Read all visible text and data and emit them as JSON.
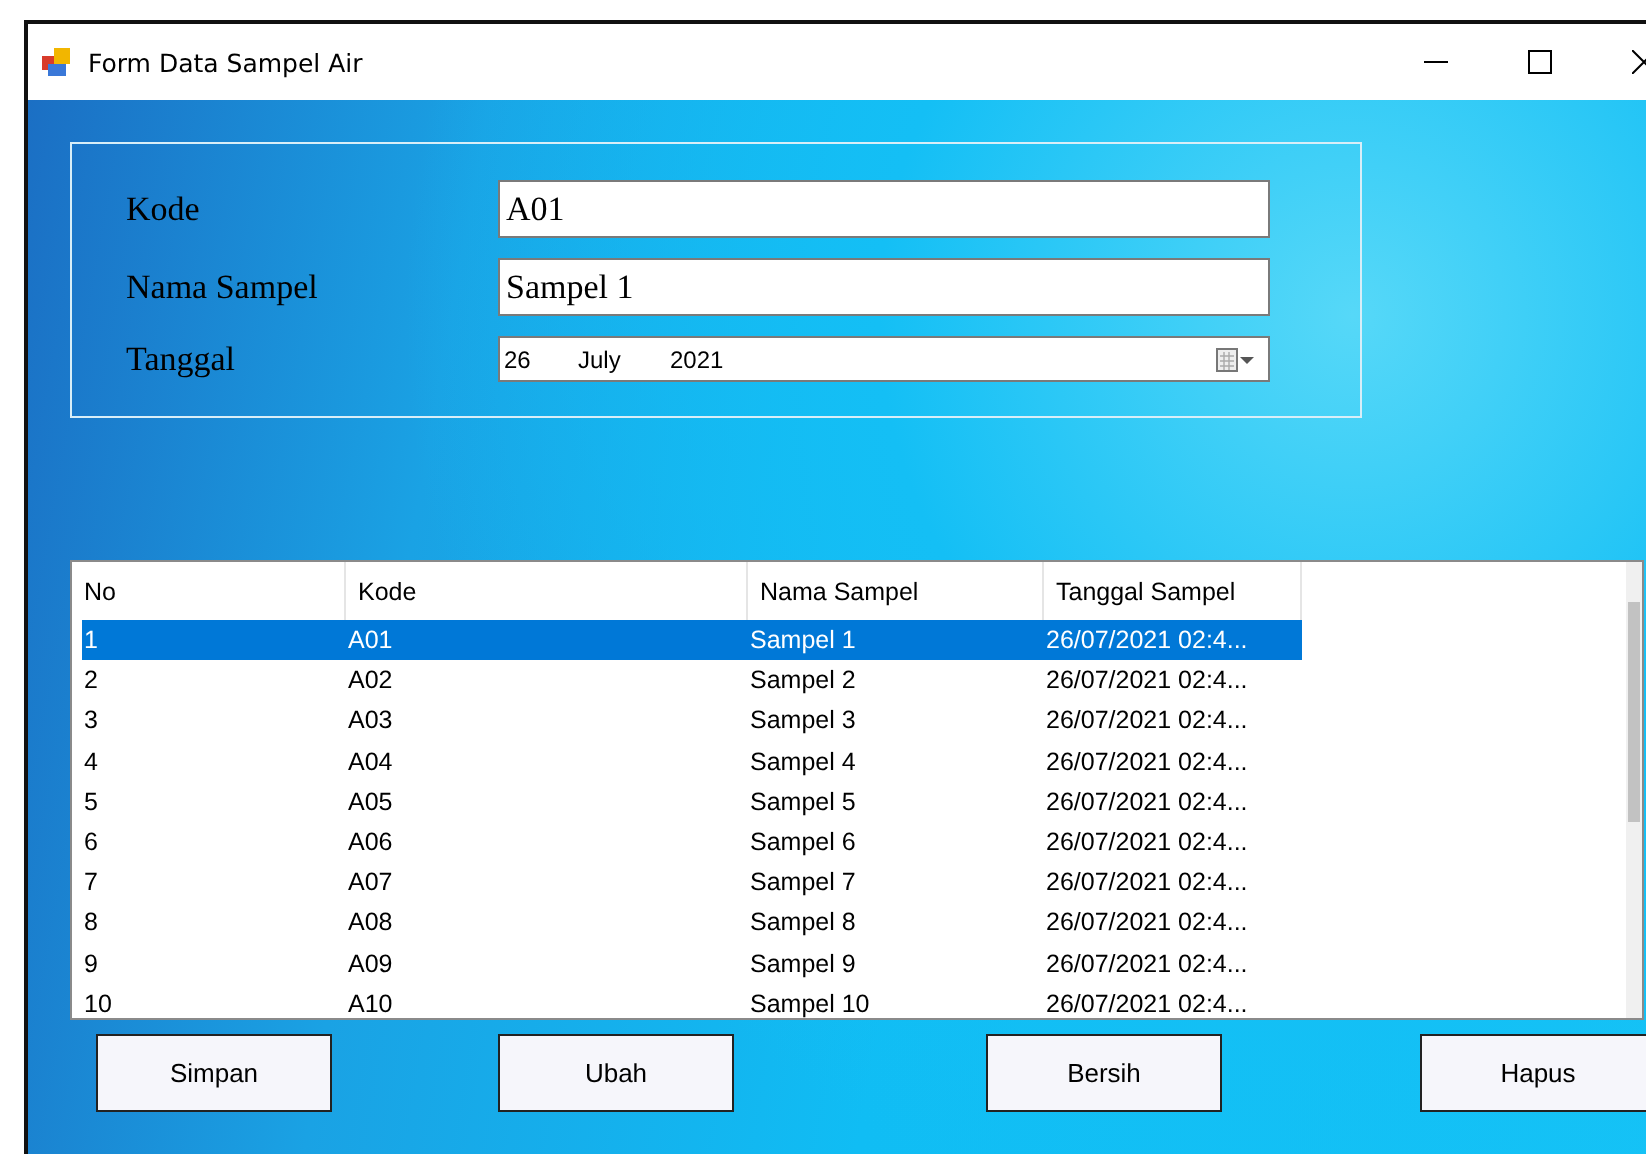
{
  "window": {
    "title": "Form Data Sampel Air"
  },
  "form": {
    "fields": [
      {
        "kind": "text",
        "label": "Kode",
        "value": "A01"
      },
      {
        "kind": "text",
        "label": "Nama Sampel",
        "value": "Sampel 1"
      },
      {
        "kind": "date",
        "label": "Tanggal",
        "day": "26",
        "month": "July",
        "year": "2021"
      }
    ]
  },
  "table": {
    "columns": [
      "No",
      "Kode",
      "Nama Sampel",
      "Tanggal Sampel"
    ],
    "rows": [
      {
        "cells": [
          "1",
          "A01",
          "Sampel 1",
          "26/07/2021 02:4..."
        ],
        "selected": true
      },
      {
        "cells": [
          "2",
          "A02",
          "Sampel 2",
          "26/07/2021 02:4..."
        ],
        "selected": false
      },
      {
        "cells": [
          "3",
          "A03",
          "Sampel 3",
          "26/07/2021 02:4..."
        ],
        "selected": false
      },
      {
        "cells": [
          "4",
          "A04",
          "Sampel 4",
          "26/07/2021 02:4..."
        ],
        "selected": false
      },
      {
        "cells": [
          "5",
          "A05",
          "Sampel 5",
          "26/07/2021 02:4..."
        ],
        "selected": false
      },
      {
        "cells": [
          "6",
          "A06",
          "Sampel 6",
          "26/07/2021 02:4..."
        ],
        "selected": false
      },
      {
        "cells": [
          "7",
          "A07",
          "Sampel 7",
          "26/07/2021 02:4..."
        ],
        "selected": false
      },
      {
        "cells": [
          "8",
          "A08",
          "Sampel 8",
          "26/07/2021 02:4..."
        ],
        "selected": false
      },
      {
        "cells": [
          "9",
          "A09",
          "Sampel 9",
          "26/07/2021 02:4..."
        ],
        "selected": false
      },
      {
        "cells": [
          "10",
          "A10",
          "Sampel 10",
          "26/07/2021 02:4..."
        ],
        "selected": false
      }
    ]
  },
  "buttons": [
    "Simpan",
    "Ubah",
    "Bersih",
    "Hapus"
  ]
}
